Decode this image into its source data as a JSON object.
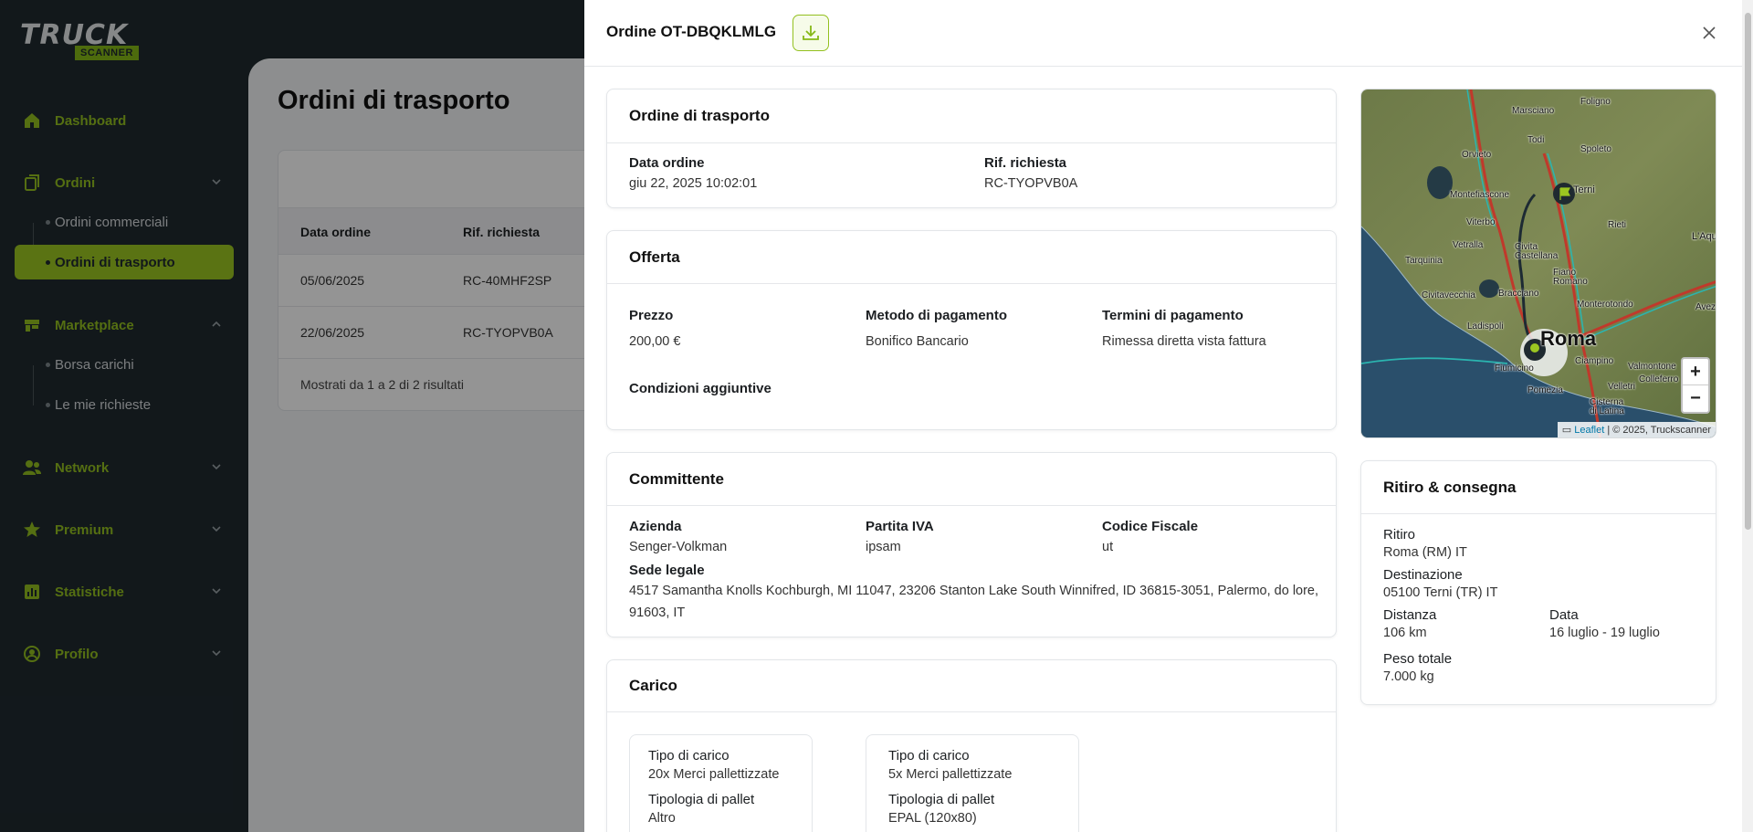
{
  "brand": {
    "word1": "TRUCK",
    "word2": "SCANNER"
  },
  "sidebar": {
    "items": [
      {
        "label": "Dashboard",
        "icon": "home-icon"
      },
      {
        "label": "Ordini",
        "icon": "document-icon",
        "expanded": true,
        "children": [
          {
            "label": "Ordini commerciali"
          },
          {
            "label": "Ordini di trasporto",
            "active": true
          }
        ]
      },
      {
        "label": "Marketplace",
        "icon": "marketplace-icon",
        "expanded": true,
        "children": [
          {
            "label": "Borsa carichi"
          },
          {
            "label": "Le mie richieste"
          }
        ]
      },
      {
        "label": "Network",
        "icon": "users-icon"
      },
      {
        "label": "Premium",
        "icon": "star-icon"
      },
      {
        "label": "Statistiche",
        "icon": "chart-icon"
      },
      {
        "label": "Profilo",
        "icon": "profile-icon"
      }
    ]
  },
  "page": {
    "title": "Ordini di trasporto",
    "table": {
      "columns": [
        "Data ordine",
        "Rif. richiesta"
      ],
      "rows": [
        [
          "05/06/2025",
          "RC-40MHF2SP"
        ],
        [
          "22/06/2025",
          "RC-TYOPVB0A"
        ]
      ],
      "footer": "Mostrati da 1 a 2 di 2 risultati"
    }
  },
  "drawer": {
    "title": "Ordine OT-DBQKLMLG",
    "ordine": {
      "title": "Ordine di trasporto",
      "data_ordine_label": "Data ordine",
      "data_ordine": "giu 22, 2025 10:02:01",
      "rif_label": "Rif. richiesta",
      "rif": "RC-TYOPVB0A"
    },
    "offerta": {
      "title": "Offerta",
      "prezzo_label": "Prezzo",
      "prezzo": "200,00 €",
      "metodo_label": "Metodo di pagamento",
      "metodo": "Bonifico Bancario",
      "termini_label": "Termini di pagamento",
      "termini": "Rimessa diretta vista fattura",
      "condizioni_label": "Condizioni aggiuntive"
    },
    "committente": {
      "title": "Committente",
      "azienda_label": "Azienda",
      "azienda": "Senger-Volkman",
      "piva_label": "Partita IVA",
      "piva": "ipsam",
      "cf_label": "Codice Fiscale",
      "cf": "ut",
      "sede_label": "Sede legale",
      "sede": "4517 Samantha Knolls Kochburgh, MI 11047, 23206 Stanton Lake South Winnifred, ID 36815-3051, Palermo, do lore, 91603, IT"
    },
    "carico": {
      "title": "Carico",
      "items": [
        {
          "tipo_label": "Tipo di carico",
          "tipo": "20x Merci pallettizzate",
          "pallet_label": "Tipologia di pallet",
          "pallet": "Altro"
        },
        {
          "tipo_label": "Tipo di carico",
          "tipo": "5x Merci pallettizzate",
          "pallet_label": "Tipologia di pallet",
          "pallet": "EPAL (120x80)"
        }
      ]
    },
    "map": {
      "labels": [
        "Foligno",
        "Marsciano",
        "Todi",
        "Spoleto",
        "Orvieto",
        "Montefiascone",
        "Terni",
        "Viterbo",
        "Rieti",
        "Vetralla",
        "Civita Castellana",
        "L'Aqu",
        "Tarquinia",
        "Fiano Romano",
        "Civitavecchia",
        "Bracciano",
        "Monterotondo",
        "Avezz",
        "Ladispoli",
        "Roma",
        "Fiumicino",
        "Ciampino",
        "Valmontone",
        "Colleferro",
        "Pomezia",
        "Velletri",
        "Cisterna di Latina"
      ],
      "zoom_in": "+",
      "zoom_out": "−",
      "attrib_link": "Leaflet",
      "attrib_text": "| © 2025, Truckscanner"
    },
    "ritiro": {
      "title": "Ritiro & consegna",
      "ritiro_label": "Ritiro",
      "ritiro": "Roma (RM) IT",
      "dest_label": "Destinazione",
      "dest": "05100 Terni (TR) IT",
      "distanza_label": "Distanza",
      "distanza": "106 km",
      "data_label": "Data",
      "data": "16 luglio - 19 luglio",
      "peso_label": "Peso totale",
      "peso": "7.000 kg"
    }
  }
}
